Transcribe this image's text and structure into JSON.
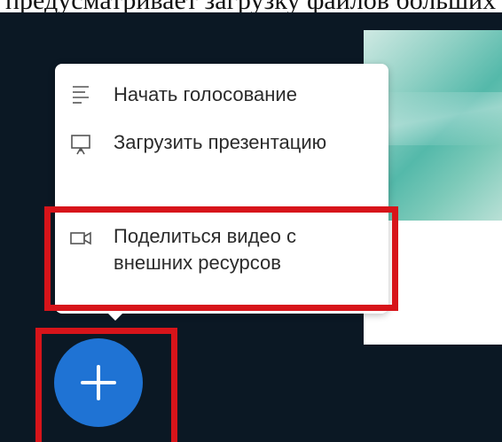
{
  "caption": {
    "text": "предусматривает загрузку файлов больших"
  },
  "menu": {
    "items": [
      {
        "label": "Начать голосование",
        "icon": "list-icon"
      },
      {
        "label": "Загрузить презентацию",
        "icon": "presentation-icon"
      },
      {
        "label": "Поделиться видео с внешних ресурсов",
        "icon": "video-camera-icon"
      }
    ]
  },
  "fab": {
    "icon": "plus-icon"
  },
  "colors": {
    "background": "#0b1824",
    "accent": "#1f73d4",
    "highlight": "#d7141a",
    "slide_teal": "#54b9aa"
  }
}
